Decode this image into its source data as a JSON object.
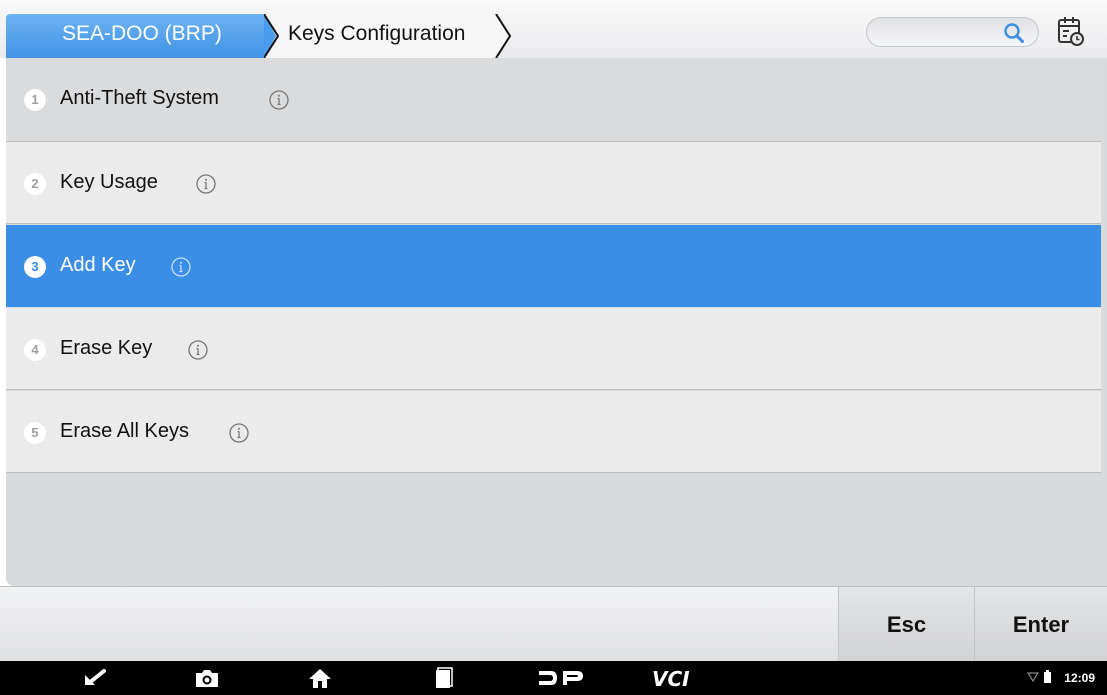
{
  "breadcrumb": {
    "home": "SEA-DOO (BRP)",
    "current": "Keys Configuration"
  },
  "search": {
    "placeholder": ""
  },
  "menu": {
    "items": [
      {
        "number": "1",
        "label": "Anti-Theft System"
      },
      {
        "number": "2",
        "label": "Key Usage"
      },
      {
        "number": "3",
        "label": "Add Key"
      },
      {
        "number": "4",
        "label": "Erase Key"
      },
      {
        "number": "5",
        "label": "Erase All Keys"
      }
    ],
    "selected_index": 3
  },
  "footer": {
    "esc_label": "Esc",
    "enter_label": "Enter"
  },
  "navbar": {
    "icons": [
      "back-icon",
      "camera-icon",
      "home-icon",
      "recents-icon",
      "dp-logo-icon",
      "vci-icon"
    ],
    "vci_label": "VCI",
    "time": "12:09"
  },
  "colors": {
    "accent": "#3a8ee6",
    "tab_home": "#4a9ded",
    "background": "#d9dadc"
  }
}
